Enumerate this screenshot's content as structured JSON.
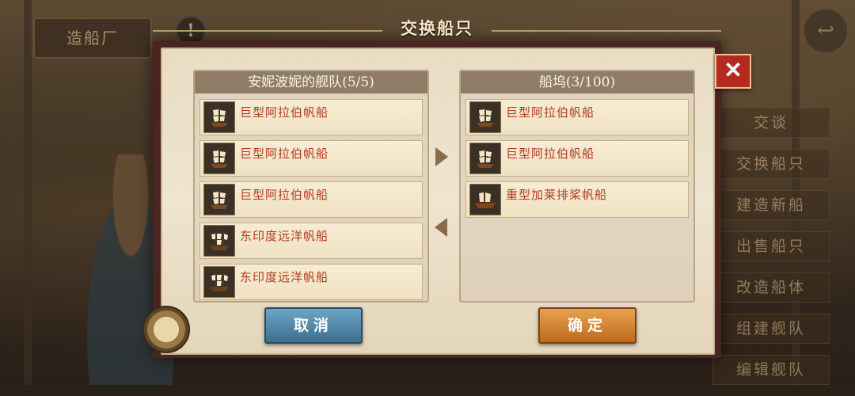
{
  "background": {
    "tab_label": "造船厂",
    "warning_icon": "!",
    "back_icon": "↩",
    "side_menu": [
      "交谈",
      "交换船只",
      "建造新船",
      "出售船只",
      "改造船体",
      "组建舰队",
      "编辑舰队"
    ]
  },
  "dialog": {
    "title": "交换船只",
    "close_label": "✕",
    "left_panel": {
      "header": "安妮波妮的舰队(5/5)",
      "ships": [
        {
          "name": "巨型阿拉伯帆船",
          "icon": "galleon-icon"
        },
        {
          "name": "巨型阿拉伯帆船",
          "icon": "galleon-icon"
        },
        {
          "name": "巨型阿拉伯帆船",
          "icon": "galleon-icon"
        },
        {
          "name": "东印度远洋帆船",
          "icon": "east-indiaman-icon"
        },
        {
          "name": "东印度远洋帆船",
          "icon": "east-indiaman-icon"
        }
      ]
    },
    "right_panel": {
      "header": "船坞(3/100)",
      "ships": [
        {
          "name": "巨型阿拉伯帆船",
          "icon": "galleon-icon"
        },
        {
          "name": "巨型阿拉伯帆船",
          "icon": "galleon-icon"
        },
        {
          "name": "重型加莱排桨帆船",
          "icon": "galley-icon"
        }
      ]
    },
    "cancel_label": "取消",
    "confirm_label": "确定"
  },
  "colors": {
    "ship_name": "#b23a1f",
    "cancel_button": "#4d86a8",
    "confirm_button": "#d8862f",
    "close_button": "#b42a22"
  }
}
